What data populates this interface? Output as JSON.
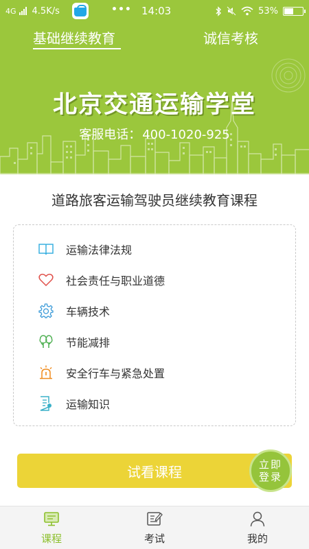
{
  "status_bar": {
    "network": "4G",
    "speed": "4.5K/s",
    "app_icon": "vivo-store-icon",
    "more": "•••",
    "time": "14:03",
    "battery_pct": "53%",
    "battery_level": 0.53
  },
  "header": {
    "tabs": [
      {
        "label": "基础继续教育",
        "active": true
      },
      {
        "label": "诚信考核",
        "active": false
      }
    ],
    "brand_title": "北京交通运输学堂",
    "hotline_label": "客服电话：",
    "hotline_number": "400-1020-925"
  },
  "course": {
    "title": "道路旅客运输驾驶员继续教育课程",
    "items": [
      {
        "label": "运输法律法规",
        "icon": "book-icon",
        "color": "#3ab0e0"
      },
      {
        "label": "社会责任与职业道德",
        "icon": "heart-icon",
        "color": "#e0504a"
      },
      {
        "label": "车辆技术",
        "icon": "gear-icon",
        "color": "#3a9ad8"
      },
      {
        "label": "节能减排",
        "icon": "tree-icon",
        "color": "#4caf50"
      },
      {
        "label": "安全行车与紧急处置",
        "icon": "alarm-light-icon",
        "color": "#f08c1e"
      },
      {
        "label": "运输知识",
        "icon": "document-icon",
        "color": "#3ab0c8"
      }
    ]
  },
  "actions": {
    "trial_label": "试看课程",
    "login_line1": "立即",
    "login_line2": "登录"
  },
  "bottom_nav": {
    "items": [
      {
        "label": "课程",
        "icon": "course-monitor-icon",
        "active": true
      },
      {
        "label": "考试",
        "icon": "exam-pencil-icon",
        "active": false
      },
      {
        "label": "我的",
        "icon": "user-icon",
        "active": false
      }
    ]
  },
  "colors": {
    "brand_green": "#9bc73c",
    "trial_yellow": "#ecd437",
    "active_nav": "#8cbf2c"
  }
}
